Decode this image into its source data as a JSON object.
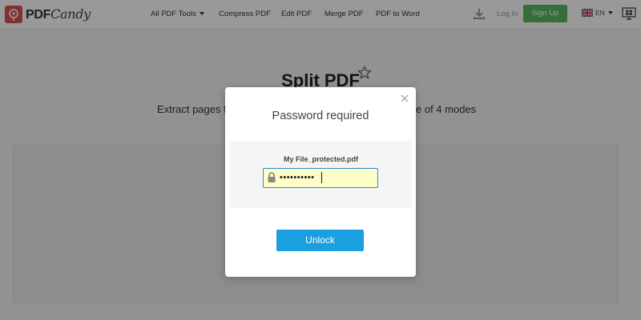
{
  "header": {
    "logo": {
      "text_bold": "PDF",
      "text_italic": "Candy",
      "icon": "pdfcandy-logo-icon"
    },
    "nav": [
      {
        "label": "All PDF Tools",
        "dropdown": true
      },
      {
        "label": "Compress PDF"
      },
      {
        "label": "Edit PDF"
      },
      {
        "label": "Merge PDF"
      },
      {
        "label": "PDF to Word"
      }
    ],
    "download_icon": "download-icon",
    "login_label": "Log In",
    "signup_label": "Sign Up",
    "language": {
      "code": "EN",
      "flag": "uk-flag-icon"
    },
    "windows_icon": "windows-app-icon"
  },
  "page": {
    "title": "Split PDF",
    "star_icon": "star-icon",
    "subtitle_left": "Extract pages f",
    "subtitle_right": "e of 4 modes"
  },
  "modal": {
    "title": "Password required",
    "close_icon": "close-icon",
    "file_name": "My File_protected.pdf",
    "password_value": "••••••••••",
    "lock_icon": "lock-icon",
    "unlock_label": "Unlock"
  },
  "colors": {
    "signup_green": "#5cb85c",
    "unlock_blue": "#1aa0e0",
    "field_focus_border": "#1f8fcf",
    "field_autofill": "#fefcc9",
    "logo_red": "#d9534f"
  }
}
